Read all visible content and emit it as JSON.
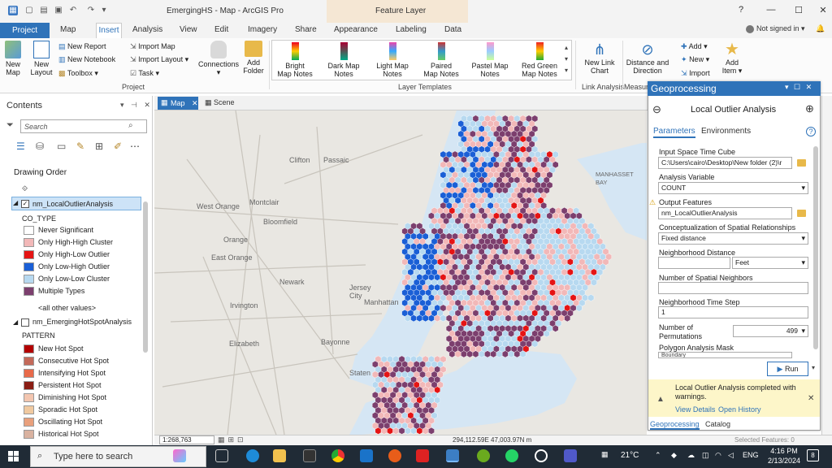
{
  "window": {
    "title": "EmergingHS - Map - ArcGIS Pro",
    "context_tab_group": "Feature Layer",
    "help": "?",
    "user": "Not signed in"
  },
  "ribbon_tabs": [
    "Project",
    "Map",
    "Insert",
    "Analysis",
    "View",
    "Edit",
    "Imagery",
    "Share",
    "Appearance",
    "Labeling",
    "Data"
  ],
  "ribbon": {
    "project": {
      "new_map": [
        "New",
        "Map"
      ],
      "new_layout": [
        "New",
        "Layout"
      ],
      "new_report": "New Report",
      "new_notebook": "New Notebook",
      "toolbox": "Toolbox",
      "import_map": "Import Map",
      "import_layout": "Import Layout",
      "task": "Task",
      "connections": "Connections",
      "add_folder": [
        "Add",
        "Folder"
      ],
      "group_label": "Project"
    },
    "layer_templates": {
      "items": [
        [
          "Bright",
          "Map Notes"
        ],
        [
          "Dark Map",
          "Notes"
        ],
        [
          "Light Map",
          "Notes"
        ],
        [
          "Paired",
          "Map Notes"
        ],
        [
          "Pastel Map",
          "Notes"
        ],
        [
          "Red Green",
          "Map Notes"
        ]
      ],
      "group_label": "Layer Templates"
    },
    "link_analysis": {
      "new_link_chart": [
        "New Link",
        "Chart"
      ],
      "group_label": "Link Analysis"
    },
    "measure": {
      "distance_direction": [
        "Distance and",
        "Direction"
      ],
      "group_label": "Measur"
    },
    "items": {
      "add": "Add",
      "new": "New",
      "import": "Import",
      "add_item": [
        "Add",
        "Item"
      ]
    }
  },
  "contents": {
    "title": "Contents",
    "search_placeholder": "Search",
    "drawing_order": "Drawing Order",
    "layer1": {
      "name": "nm_LocalOutlierAnalysis",
      "field": "CO_TYPE",
      "legend": [
        {
          "label": "Never Significant",
          "color": "#ffffff"
        },
        {
          "label": "Only High-High Cluster",
          "color": "#f2b8b8"
        },
        {
          "label": "Only High-Low Outlier",
          "color": "#e51414"
        },
        {
          "label": "Only Low-High Outlier",
          "color": "#1a5fd6"
        },
        {
          "label": "Only Low-Low Cluster",
          "color": "#b7d9f0"
        },
        {
          "label": "Multiple Types",
          "color": "#7c3f6e"
        }
      ],
      "other_values": "<all other values>"
    },
    "layer2": {
      "name": "nm_EmergingHotSpotAnalysis",
      "field": "PATTERN",
      "legend": [
        {
          "label": "New Hot Spot",
          "color": "#b30000"
        },
        {
          "label": "Consecutive Hot Spot",
          "color": "#c46a5a"
        },
        {
          "label": "Intensifying Hot Spot",
          "color": "#e86a4a"
        },
        {
          "label": "Persistent Hot Spot",
          "color": "#8a1d14"
        },
        {
          "label": "Diminishing Hot Spot",
          "color": "#f3c6b0"
        },
        {
          "label": "Sporadic Hot Spot",
          "color": "#f0c9a0"
        },
        {
          "label": "Oscillating Hot Spot",
          "color": "#e9a07c"
        },
        {
          "label": "Historical Hot Spot",
          "color": "#d9b2a0"
        }
      ]
    }
  },
  "map": {
    "tab_map": "Map",
    "tab_scene": "Scene",
    "labels": [
      "Clifton",
      "Passaic",
      "West Orange",
      "Montclair",
      "Bloomfield",
      "Orange",
      "East Orange",
      "Newark",
      "Irvington",
      "Jersey City",
      "Manhattan",
      "Elizabeth",
      "Bayonne",
      "MANHASSET BAY",
      "Staten"
    ],
    "scale": "1:268,763",
    "coords": "294,112.59E 47,003.97N m",
    "selected_features": "Selected Features: 0"
  },
  "geoprocessing": {
    "title": "Geoprocessing",
    "tool": "Local Outlier Analysis",
    "tab_parameters": "Parameters",
    "tab_environments": "Environments",
    "params": {
      "input_label": "Input Space Time Cube",
      "input_value": "C:\\Users\\cairo\\Desktop\\New folder (2)\\r",
      "analysis_var_label": "Analysis Variable",
      "analysis_var_value": "COUNT",
      "output_label": "Output Features",
      "output_value": "nm_LocalOutlierAnalysis",
      "concept_label": "Conceptualization of Spatial Relationships",
      "concept_value": "Fixed distance",
      "neigh_dist_label": "Neighborhood Distance",
      "neigh_dist_unit": "Feet",
      "num_neighbors_label": "Number of Spatial Neighbors",
      "time_step_label": "Neighborhood Time Step",
      "time_step_value": "1",
      "permutations_label": [
        "Number of",
        "Permutations"
      ],
      "permutations_value": "499",
      "mask_label": "Polygon Analysis Mask",
      "mask_value": "Boundary"
    },
    "run": "Run",
    "message": "Local Outlier Analysis completed with warnings.",
    "view_details": "View Details",
    "open_history": "Open History",
    "bottom_tab1": "Geoprocessing",
    "bottom_tab2": "Catalog"
  },
  "taskbar": {
    "search_placeholder": "Type here to search",
    "temperature": "21°C",
    "language": "ENG",
    "time": "4:16 PM",
    "date": "2/13/2024",
    "notifications": "8"
  },
  "colors": {
    "accent": "#2f73b9",
    "never": "#b7d9f0",
    "high_high": "#f2b8b8",
    "multiple": "#7c3f6e",
    "low_high": "#1a5fd6",
    "high_low": "#e51414"
  }
}
